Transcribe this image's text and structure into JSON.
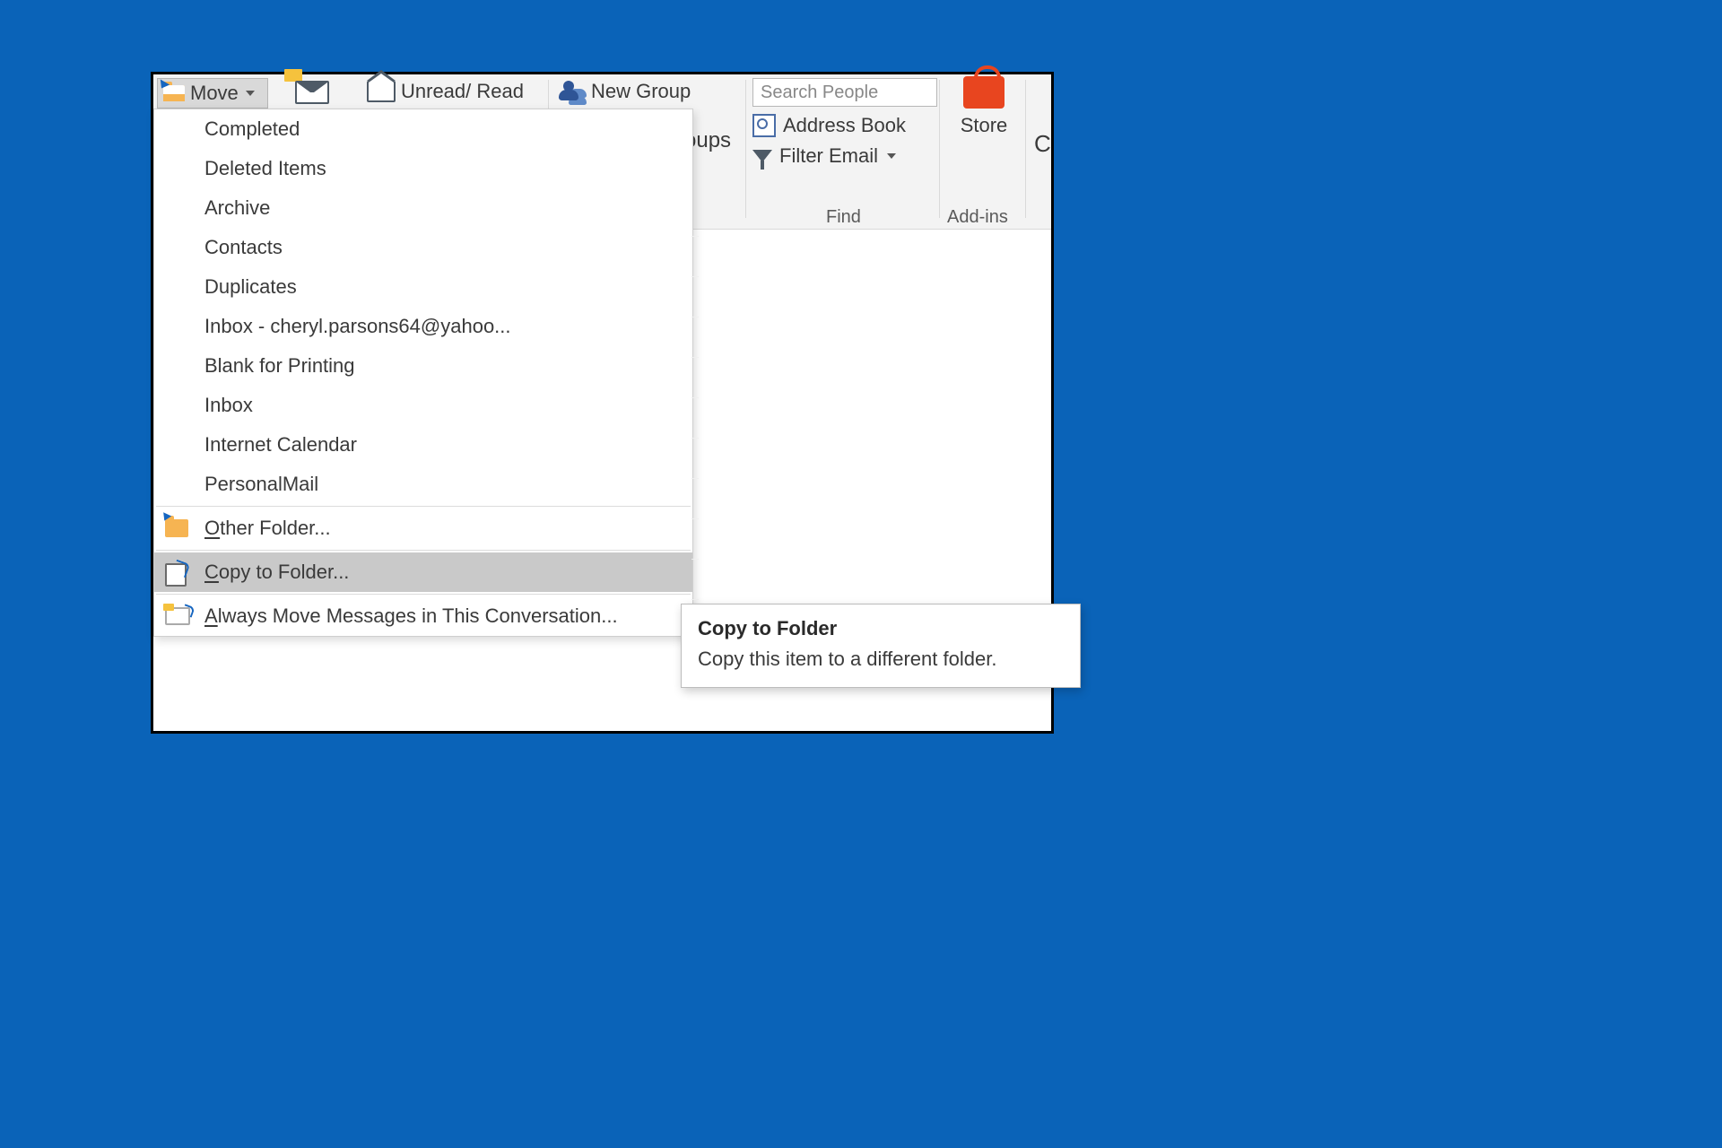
{
  "ribbon": {
    "move_label": "Move",
    "unread_label": "Unread/ Read",
    "new_group_label": "New Group",
    "partial_groups": "oups",
    "search_placeholder": "Search People",
    "address_book_label": "Address Book",
    "filter_email_label": "Filter Email",
    "find_group": "Find",
    "store_label": "Store",
    "addins_group": "Add-ins",
    "cut_letter": "C"
  },
  "dropdown": {
    "folders": [
      "Completed",
      "Deleted Items",
      "Archive",
      "Contacts",
      "Duplicates",
      "Inbox - cheryl.parsons64@yahoo...",
      "Blank for Printing",
      "Inbox",
      "Internet Calendar",
      "PersonalMail"
    ],
    "other_folder": "Other Folder...",
    "copy_to_folder": "Copy to Folder...",
    "always_move": "Always Move Messages in This Conversation..."
  },
  "tooltip": {
    "title": "Copy to Folder",
    "body": "Copy this item to a different folder."
  }
}
